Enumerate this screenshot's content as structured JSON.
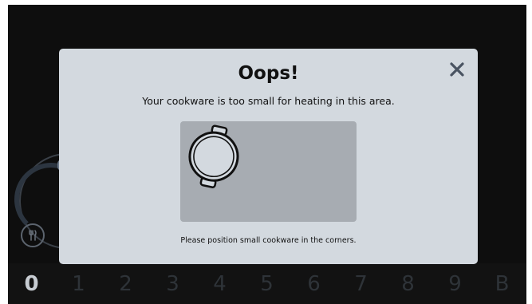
{
  "dialog": {
    "title": "Oops!",
    "message": "Your cookware is too small for heating in this area.",
    "hint": "Please position small cookware in the corners.",
    "close_icon": "close-icon",
    "illustration_icon": "small-pot-icon"
  },
  "background": {
    "power_levels": [
      "0",
      "1",
      "2",
      "3",
      "4",
      "5",
      "6",
      "7",
      "8",
      "9",
      "B"
    ],
    "selected_level": "0",
    "fork_icon": "fork-knife-icon"
  },
  "colors": {
    "dialog_bg": "#d3d9df",
    "illustration_bg": "#a7acb2",
    "screen_bg": "#0e0e0e",
    "text": "#111111"
  }
}
